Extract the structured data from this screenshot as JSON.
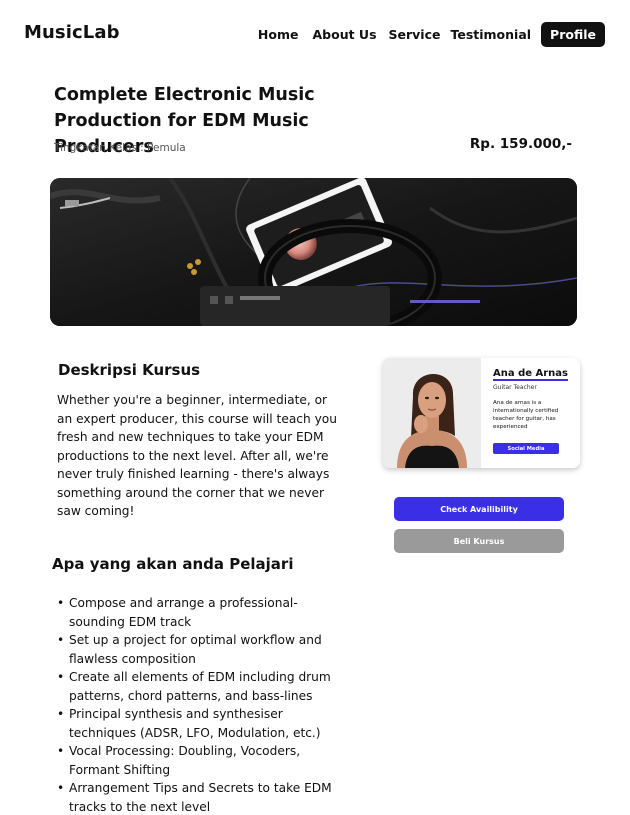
{
  "nav": {
    "brand": "MusicLab",
    "links": [
      "Home",
      "About Us",
      "Service",
      "Testimonial"
    ],
    "profile": "Profile"
  },
  "course": {
    "title": "Complete Electronic Music Production for EDM Music Producers",
    "level": "Tingkatan Kelas : Pemula",
    "price": "Rp. 159.000,-"
  },
  "description": {
    "heading": "Deskripsi Kursus",
    "text": "Whether you're a beginner, intermediate, or an expert producer, this course will teach you fresh and new techniques to take your EDM productions to the next level. After all, we're never truly finished learning - there's always something around the corner that we never saw coming!"
  },
  "learn": {
    "heading": "Apa yang akan anda Pelajari",
    "items": [
      "Compose and arrange a professional-sounding EDM track",
      "Set up a project for optimal workflow and flawless composition",
      "Create all elements of EDM including drum patterns, chord patterns, and bass-lines",
      "Principal synthesis and synthesiser techniques (ADSR, LFO, Modulation, etc.)",
      "Vocal Processing: Doubling, Vocoders, Formant Shifting",
      "Arrangement Tips and Secrets to take EDM tracks to the next level"
    ]
  },
  "teacher": {
    "name": "Ana de Arnas",
    "role": "Guitar Teacher",
    "bio": "Ana de arnas is a internationally certified teacher for guitar, has experienced",
    "social": "Social Media"
  },
  "actions": {
    "check": "Check Availibility",
    "buy": "Beli Kursus"
  },
  "colors": {
    "accent": "#3a2fe6",
    "primary_text": "#111111",
    "disabled_button": "#9a9a9a"
  }
}
